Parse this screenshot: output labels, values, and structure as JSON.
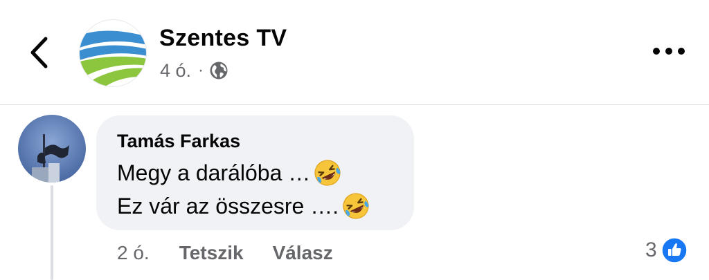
{
  "header": {
    "page_name": "Szentes TV",
    "post_time": "4 ó.",
    "separator": "·",
    "audience_icon": "globe-icon",
    "back_icon": "chevron-left-icon",
    "more_icon": "more-horizontal-icon",
    "logo_colors": {
      "blue": "#3b8fd0",
      "green": "#8cc63f"
    }
  },
  "comment": {
    "author": "Tamás Farkas",
    "lines": [
      {
        "text": "Megy a darálóba …",
        "emoji": "rolling-on-floor-laughing-emoji"
      },
      {
        "text": "Ez vár az összesre ….",
        "emoji": "rolling-on-floor-laughing-emoji"
      }
    ],
    "time": "2 ó.",
    "like_label": "Tetszik",
    "reply_label": "Válasz",
    "reaction_count": "3",
    "reaction_icon": "like-icon"
  },
  "colors": {
    "text_primary": "#050505",
    "text_secondary": "#65676b",
    "bubble_bg": "#f0f2f5",
    "divider": "#dadde1",
    "like_blue": "#1877f2"
  }
}
